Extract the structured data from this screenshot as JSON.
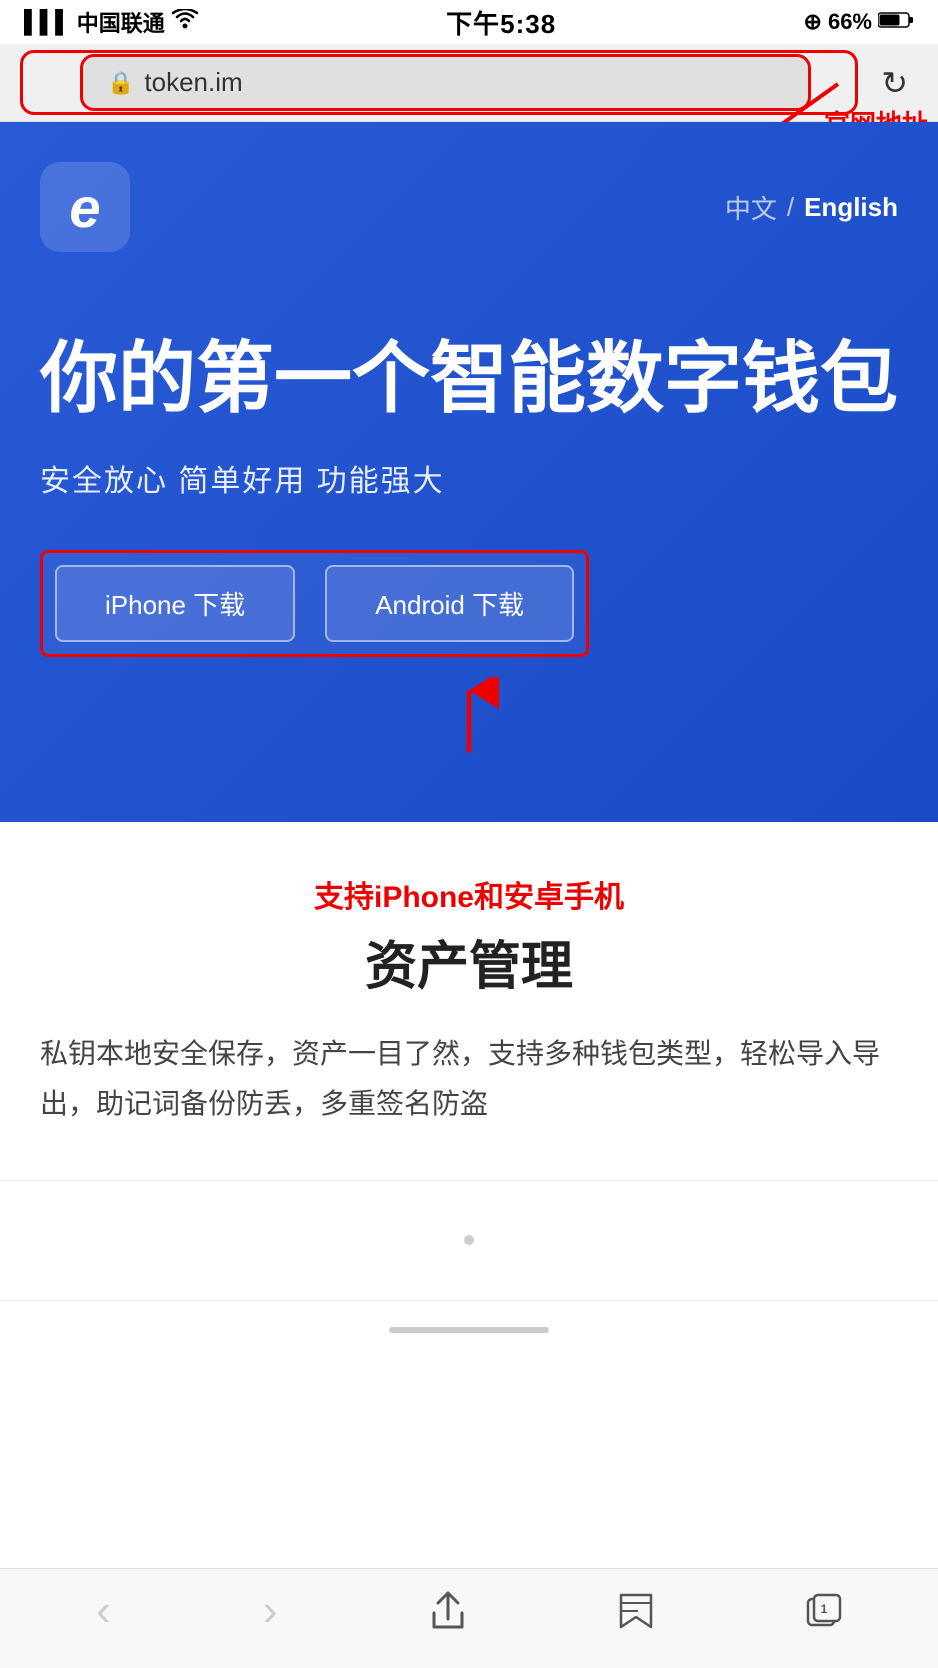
{
  "status_bar": {
    "carrier": "中国联通",
    "time": "下午5:38",
    "battery": "66%"
  },
  "browser": {
    "url": "token.im",
    "lock_symbol": "🔒",
    "official_label": "官网地址",
    "reload_icon": "↻"
  },
  "hero": {
    "logo_char": "ε",
    "lang_cn": "中文",
    "lang_divider": "/",
    "lang_en": "English",
    "title": "你的第一个智能数字钱包",
    "subtitle": "安全放心  简单好用  功能强大",
    "iphone_btn": "iPhone 下载",
    "android_btn": "Android 下载"
  },
  "content": {
    "annotation": "支持iPhone和安卓手机",
    "section_title": "资产管理",
    "section_desc": "私钥本地安全保存，资产一目了然，支持多种钱包类型，轻松导入导出，助记词备份防丢，多重签名防盗"
  },
  "toolbar": {
    "back": "‹",
    "forward": "›",
    "share": "⬆",
    "bookmarks": "📖",
    "tabs": "⧉"
  },
  "colors": {
    "hero_bg": "#2a5bd7",
    "red_annotation": "#e00000",
    "text_primary": "#222222",
    "text_muted": "#444444"
  }
}
